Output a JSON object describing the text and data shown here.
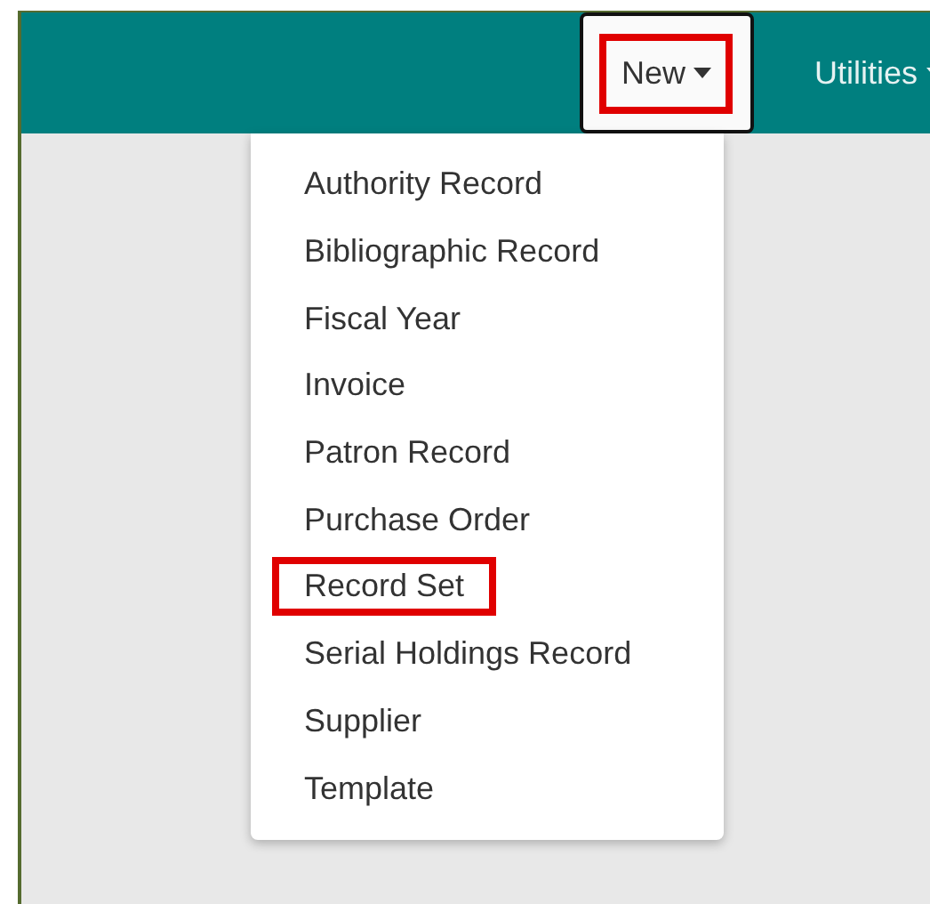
{
  "navbar": {
    "menus": [
      {
        "label": "New",
        "open": true,
        "highlighted": true
      },
      {
        "label": "Utilities",
        "open": false,
        "highlighted": false
      }
    ]
  },
  "dropdown": {
    "items": [
      {
        "label": "Authority Record",
        "highlighted": false
      },
      {
        "label": "Bibliographic Record",
        "highlighted": false
      },
      {
        "label": "Fiscal Year",
        "highlighted": false
      },
      {
        "label": "Invoice",
        "highlighted": false
      },
      {
        "label": "Patron Record",
        "highlighted": false
      },
      {
        "label": "Purchase Order",
        "highlighted": false
      },
      {
        "label": "Record Set",
        "highlighted": true
      },
      {
        "label": "Serial Holdings Record",
        "highlighted": false
      },
      {
        "label": "Supplier",
        "highlighted": false
      },
      {
        "label": "Template",
        "highlighted": false
      }
    ]
  }
}
